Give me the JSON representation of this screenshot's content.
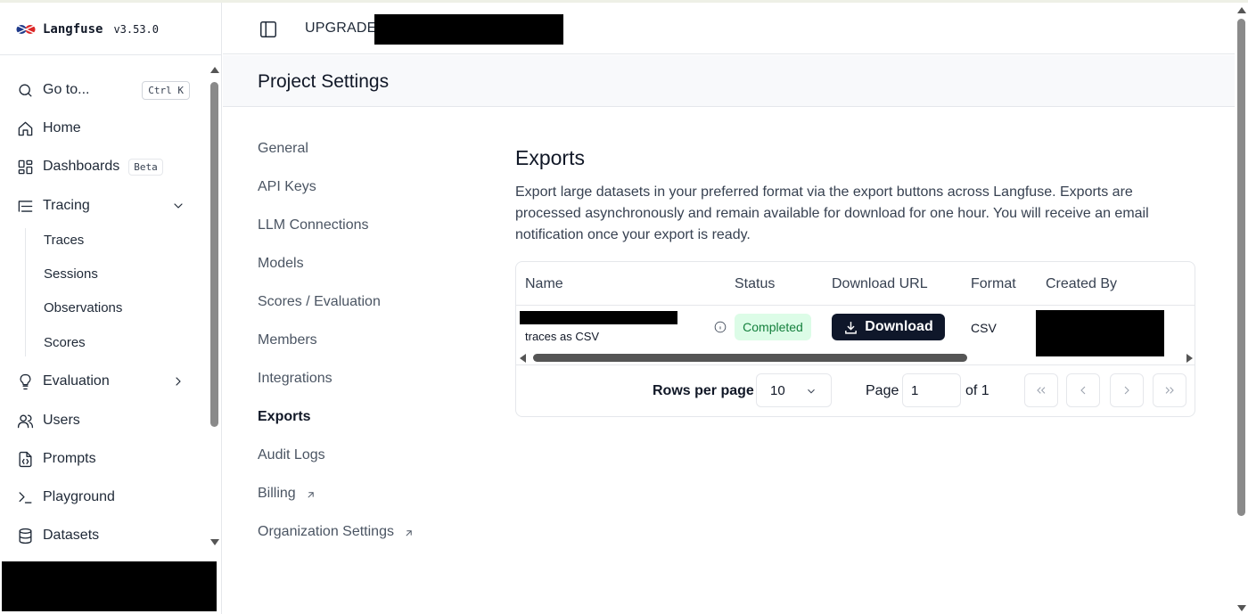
{
  "brand": {
    "name": "Langfuse",
    "version": "v3.53.0"
  },
  "sidebar": {
    "goto": {
      "label": "Go to...",
      "shortcut": "Ctrl K"
    },
    "items": [
      {
        "label": "Home",
        "icon": "home-icon"
      },
      {
        "label": "Dashboards",
        "icon": "dashboard-icon",
        "badge": "Beta"
      },
      {
        "label": "Tracing",
        "icon": "tracing-icon",
        "expanded": true
      },
      {
        "label": "Evaluation",
        "icon": "lightbulb-icon",
        "expanded": false
      },
      {
        "label": "Users",
        "icon": "users-icon"
      },
      {
        "label": "Prompts",
        "icon": "file-code-icon"
      },
      {
        "label": "Playground",
        "icon": "terminal-icon"
      },
      {
        "label": "Datasets",
        "icon": "database-icon"
      }
    ],
    "tracing_children": [
      "Traces",
      "Sessions",
      "Observations",
      "Scores"
    ]
  },
  "header": {
    "upgrade_label": "UPGRADE"
  },
  "page": {
    "title": "Project Settings"
  },
  "settings_nav": [
    {
      "label": "General",
      "active": false
    },
    {
      "label": "API Keys",
      "active": false
    },
    {
      "label": "LLM Connections",
      "active": false
    },
    {
      "label": "Models",
      "active": false
    },
    {
      "label": "Scores / Evaluation",
      "active": false
    },
    {
      "label": "Members",
      "active": false
    },
    {
      "label": "Integrations",
      "active": false
    },
    {
      "label": "Exports",
      "active": true
    },
    {
      "label": "Audit Logs",
      "active": false
    },
    {
      "label": "Billing",
      "active": false,
      "external": true
    },
    {
      "label": "Organization Settings",
      "active": false,
      "external": true
    }
  ],
  "exports": {
    "title": "Exports",
    "description": "Export large datasets in your preferred format via the export buttons across Langfuse. Exports are processed asynchronously and remain available for download for one hour. You will receive an email notification once your export is ready.",
    "columns": [
      "Name",
      "Status",
      "Download URL",
      "Format",
      "Created By"
    ],
    "rows": [
      {
        "name_sub": "traces as CSV",
        "status": "Completed",
        "download_label": "Download",
        "format": "CSV"
      }
    ],
    "pagination": {
      "rows_per_page_label": "Rows per page",
      "rows_per_page": "10",
      "page_label": "Page",
      "page_value": "1",
      "of_label": "of 1"
    }
  },
  "colors": {
    "status_bg": "#dcfce7",
    "status_text": "#15803d",
    "primary_button": "#0f172a"
  }
}
